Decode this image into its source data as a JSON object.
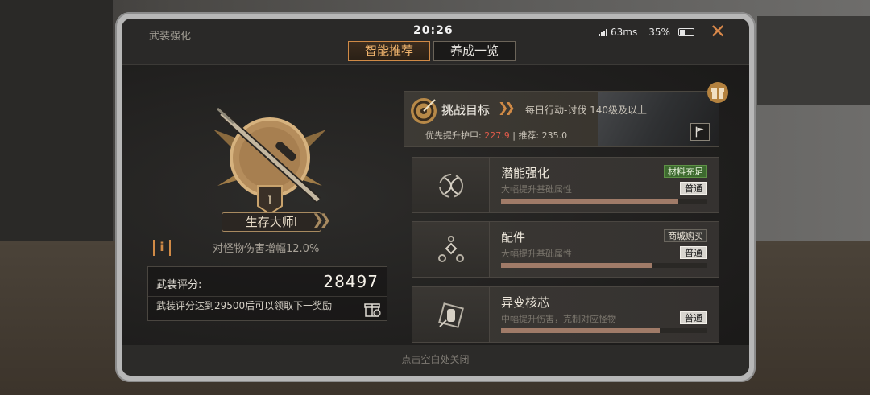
{
  "header": {
    "title": "武装强化",
    "time": "20:26",
    "ping": "63ms",
    "battery": "35%",
    "close_symbol": "✕"
  },
  "tabs": [
    {
      "label": "智能推荐",
      "active": true
    },
    {
      "label": "养成一览",
      "active": false
    }
  ],
  "rank": {
    "name": "生存大师Ⅰ",
    "emblem_numeral": "Ⅰ",
    "bonus": "对怪物伤害增幅12.0%",
    "info_symbol": "i"
  },
  "score": {
    "label": "武装评分:",
    "value": "28497",
    "note": "武装评分达到29500后可以领取下一奖励"
  },
  "challenge": {
    "title": "挑战目标",
    "task": "每日行动-讨伐 140级及以上",
    "priority_label": "优先提升护甲:",
    "armor_value": "227.9",
    "separator": "|",
    "recommend_label": "推荐:",
    "recommend_value": "235.0"
  },
  "cards": [
    {
      "title": "潜能强化",
      "subtitle": "大幅提升基础属性",
      "tag": "材料充足",
      "tag_style": "green",
      "grade": "普通",
      "progress": 0.86,
      "icon": "dna-icon"
    },
    {
      "title": "配件",
      "subtitle": "大幅提升基础属性",
      "tag": "商城购买",
      "tag_style": "gray",
      "grade": "普通",
      "progress": 0.73,
      "icon": "attachment-icon"
    },
    {
      "title": "异变核芯",
      "subtitle": "中幅提升伤害，克制对应怪物",
      "tag": "",
      "tag_style": "",
      "grade": "普通",
      "progress": 0.77,
      "icon": "core-icon"
    }
  ],
  "footer": {
    "hint": "点击空白处关闭"
  },
  "colors": {
    "accent": "#d08a46",
    "armor_red": "#e05a4a",
    "progress": "#a07b68",
    "tag_green": "#3d6a2f"
  }
}
